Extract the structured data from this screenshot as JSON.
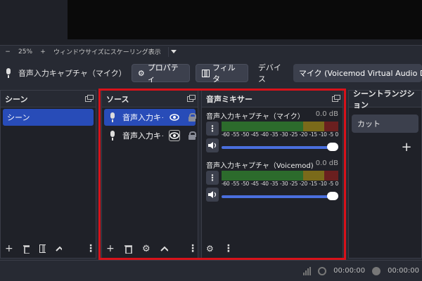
{
  "zoom": {
    "minus": "−",
    "percent": "25%",
    "plus": "+",
    "scale_label": "ウィンドウサイズにスケーリング表示"
  },
  "context_bar": {
    "source_name": "音声入力キャプチャ（マイク）",
    "properties_label": "プロパティ",
    "filters_label": "フィルタ",
    "device_label": "デバイス",
    "device_value": "マイク (Voicemod Virtual Audio Device"
  },
  "scenes": {
    "title": "シーン",
    "items": [
      "シーン"
    ]
  },
  "sources": {
    "title": "ソース",
    "items": [
      {
        "label": "音声入力キャプチャ"
      },
      {
        "label": "音声入力キャプチャ"
      }
    ]
  },
  "mixer": {
    "title": "音声ミキサー",
    "channels": [
      {
        "name": "音声入力キャプチャ（マイク）",
        "db": "0.0 dB",
        "volume": 1.0
      },
      {
        "name": "音声入力キャプチャ（Voicemod)",
        "db": "0.0 dB",
        "volume": 1.0
      }
    ],
    "ticks": [
      "-60",
      "-55",
      "-50",
      "-45",
      "-40",
      "-35",
      "-30",
      "-25",
      "-20",
      "-15",
      "-10",
      "-5",
      "0"
    ]
  },
  "transitions": {
    "title": "シーントランジション",
    "selected": "カット",
    "add": "+"
  },
  "status": {
    "stream_time": "00:00:00",
    "rec_time": "00:00:00"
  },
  "colors": {
    "accent": "#284cb8",
    "highlight": "#d8121a",
    "slider": "#4a6fde"
  }
}
